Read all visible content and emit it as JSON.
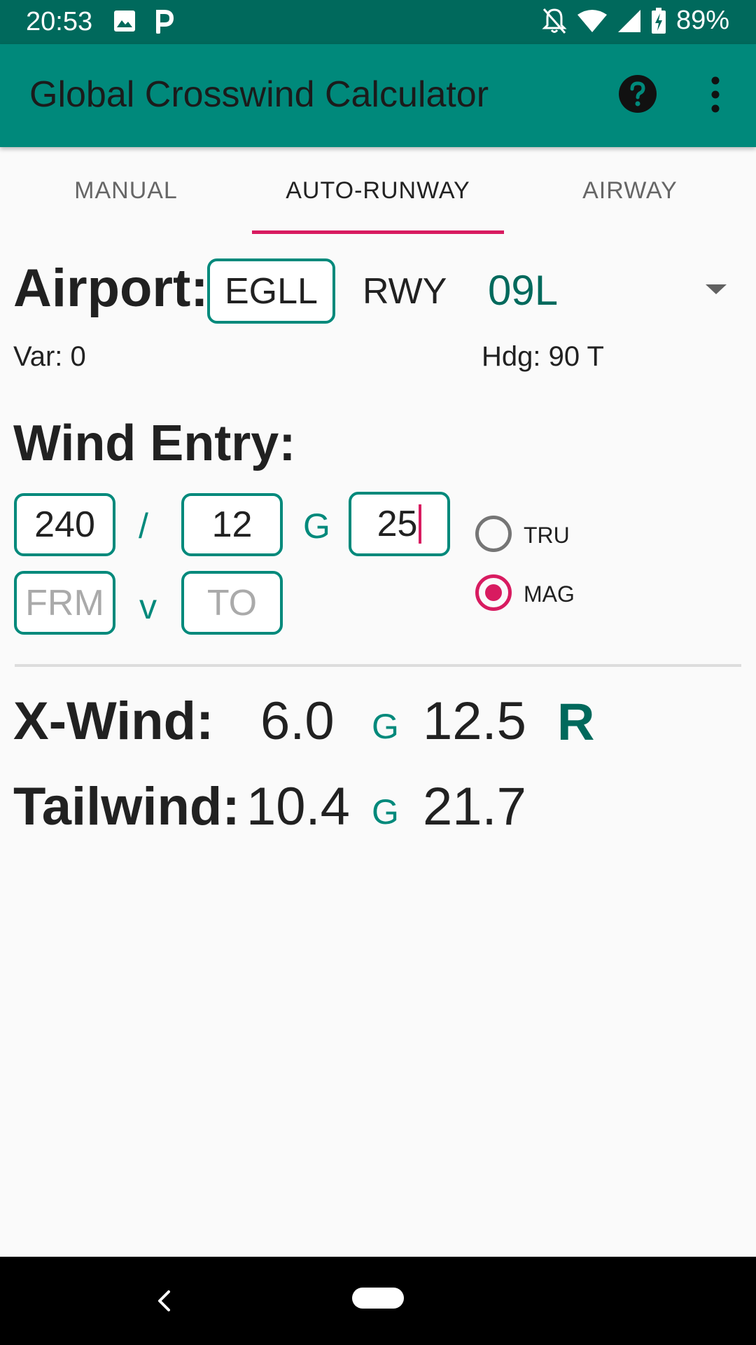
{
  "status_bar": {
    "time": "20:53",
    "battery": "89%",
    "icons": [
      "image-icon",
      "parking-icon",
      "bell-off-icon",
      "wifi-icon",
      "signal-icon",
      "battery-charging-icon"
    ]
  },
  "app_bar": {
    "title": "Global Crosswind Calculator",
    "icons": [
      "help-icon",
      "overflow-menu-icon"
    ]
  },
  "tabs": [
    {
      "label": "MANUAL"
    },
    {
      "label": "AUTO-RUNWAY"
    },
    {
      "label": "AIRWAY"
    }
  ],
  "active_tab": "AUTO-RUNWAY",
  "airport": {
    "label": "Airport:",
    "code": "EGLL",
    "rwy_label": "RWY",
    "runway": "09L",
    "variation": "Var: 0",
    "heading": "Hdg: 90 T"
  },
  "wind_entry": {
    "title": "Wind Entry:",
    "direction": "240",
    "slash": "/",
    "speed": "12",
    "gust_sep": "G",
    "gust": "25",
    "variable_sep": "v",
    "from_placeholder": "FRM",
    "to_placeholder": "TO",
    "reference_options": [
      {
        "label": "TRU",
        "selected": false
      },
      {
        "label": "MAG",
        "selected": true
      }
    ]
  },
  "results": {
    "xwind_label": "X-Wind:",
    "xwind": "6.0",
    "xwind_g": "G",
    "xwind_gust": "12.5",
    "xwind_side": "R",
    "tailwind_label": "Tailwind:",
    "tailwind": "10.4",
    "tailwind_g": "G",
    "tailwind_gust": "21.7"
  },
  "colors": {
    "primary": "#00897b",
    "primary_dark": "#00695c",
    "accent": "#d81b60",
    "background": "#fafafa"
  }
}
